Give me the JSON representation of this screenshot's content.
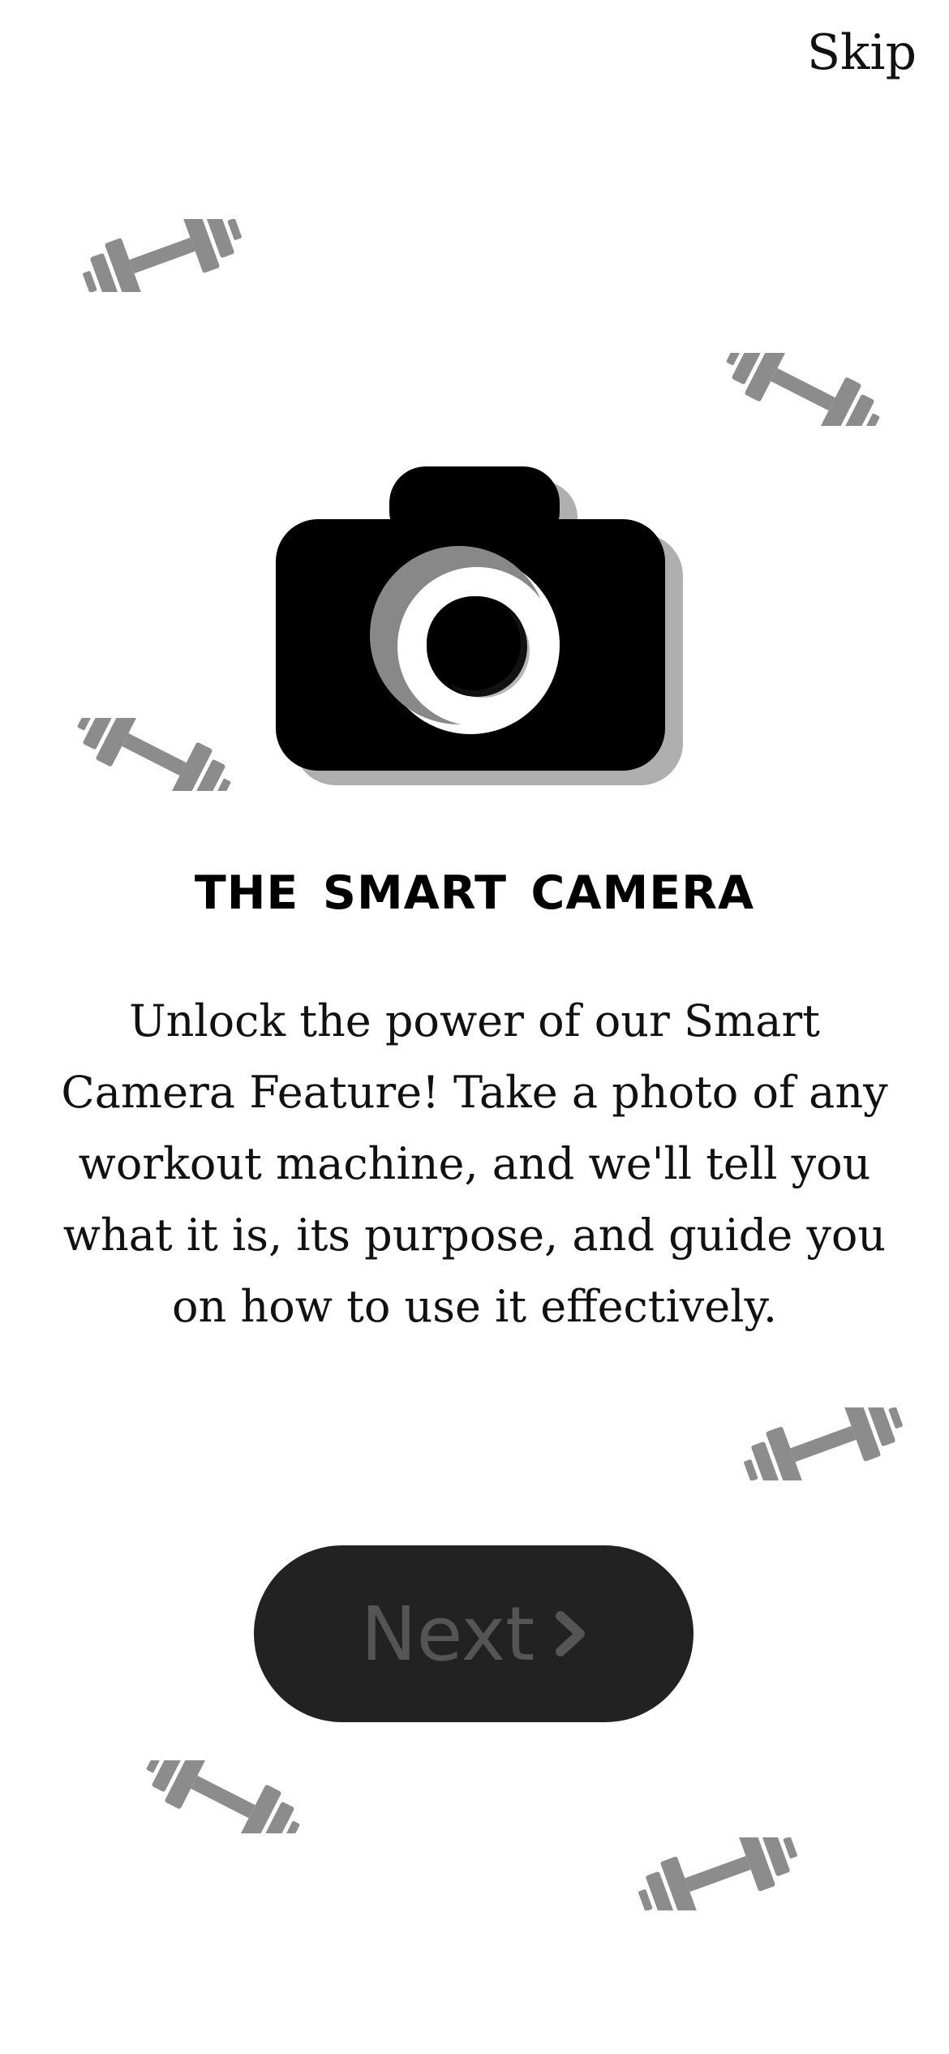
{
  "skip": {
    "label": "Skip"
  },
  "title": "The Smart Camera",
  "description": "Unlock the power of our Smart Camera Feature! Take a photo of any workout machine, and we'll tell you what it is, its purpose, and guide you on how to use it effectively.",
  "next": {
    "label": "Next",
    "icon": "chevron-right-icon"
  },
  "hero_icon": "camera-icon",
  "decorations": {
    "icon": "dumbbell-icon",
    "count": 6
  },
  "colors": {
    "background": "#ffffff",
    "dumbbell": "#8c8c8c",
    "button_bg": "#222222",
    "button_text": "#555555",
    "camera": "#000000"
  }
}
